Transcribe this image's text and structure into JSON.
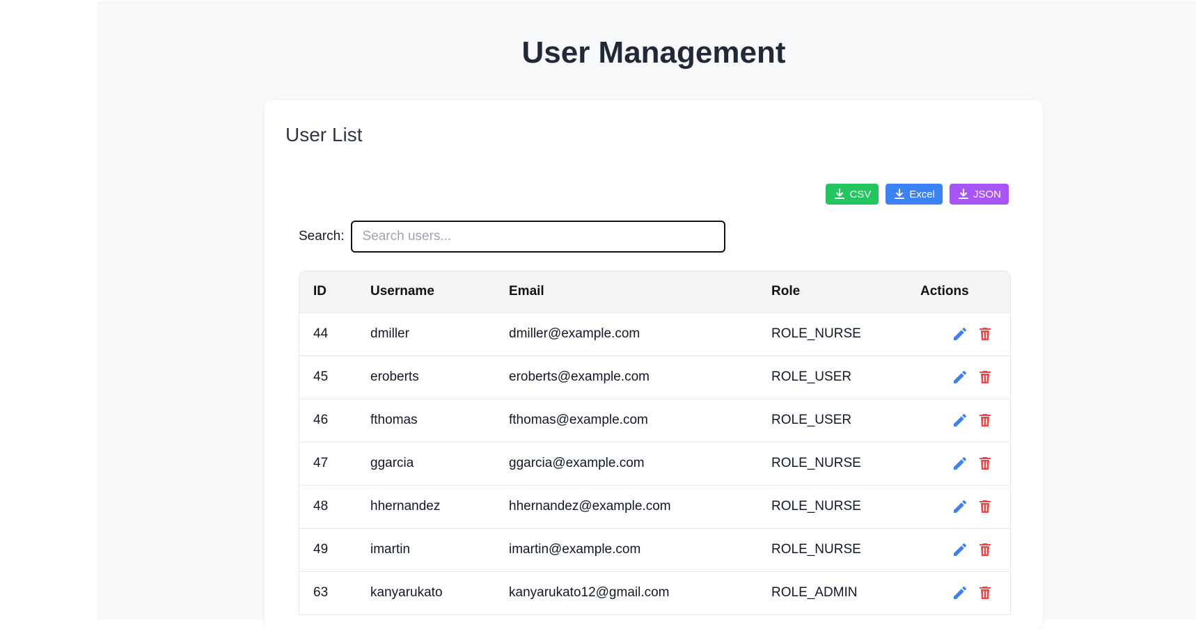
{
  "page": {
    "title": "User Management"
  },
  "card": {
    "title": "User List"
  },
  "export": {
    "csv_label": "CSV",
    "excel_label": "Excel",
    "json_label": "JSON",
    "icon": "download-icon",
    "colors": {
      "csv": "#22c55e",
      "excel": "#3b82f6",
      "json": "#a855f7"
    }
  },
  "search": {
    "label": "Search:",
    "placeholder": "Search users...",
    "value": ""
  },
  "table": {
    "headers": [
      "ID",
      "Username",
      "Email",
      "Role",
      "Actions"
    ],
    "rows": [
      {
        "id": "44",
        "username": "dmiller",
        "email": "dmiller@example.com",
        "role": "ROLE_NURSE"
      },
      {
        "id": "45",
        "username": "eroberts",
        "email": "eroberts@example.com",
        "role": "ROLE_USER"
      },
      {
        "id": "46",
        "username": "fthomas",
        "email": "fthomas@example.com",
        "role": "ROLE_USER"
      },
      {
        "id": "47",
        "username": "ggarcia",
        "email": "ggarcia@example.com",
        "role": "ROLE_NURSE"
      },
      {
        "id": "48",
        "username": "hhernandez",
        "email": "hhernandez@example.com",
        "role": "ROLE_NURSE"
      },
      {
        "id": "49",
        "username": "imartin",
        "email": "imartin@example.com",
        "role": "ROLE_NURSE"
      },
      {
        "id": "63",
        "username": "kanyarukato",
        "email": "kanyarukato12@gmail.com",
        "role": "ROLE_ADMIN"
      }
    ],
    "action_icons": {
      "edit": "pencil-icon",
      "delete": "trash-icon"
    },
    "action_colors": {
      "edit": "#3b82f6",
      "delete": "#ef4444"
    }
  }
}
